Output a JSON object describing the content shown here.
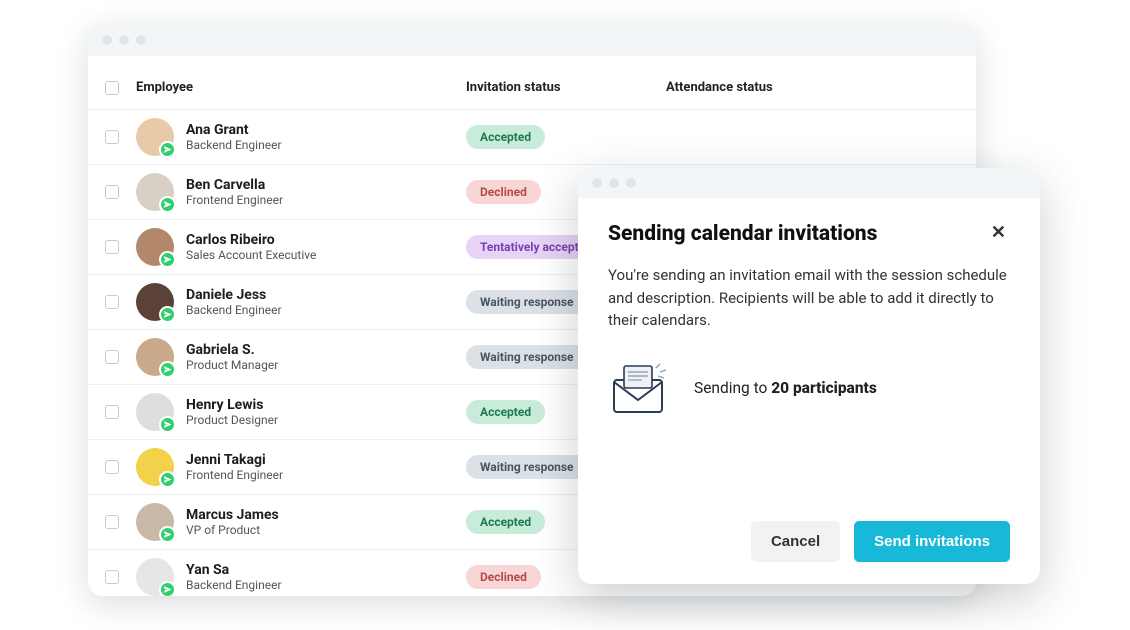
{
  "columns": {
    "employee": "Employee",
    "invitation": "Invitation status",
    "attendance": "Attendance status"
  },
  "status_labels": {
    "accepted": "Accepted",
    "declined": "Declined",
    "tentative": "Tentatively accepted",
    "waiting": "Waiting response"
  },
  "rows": [
    {
      "name": "Ana Grant",
      "role": "Backend Engineer",
      "status": "accepted"
    },
    {
      "name": "Ben Carvella",
      "role": "Frontend Engineer",
      "status": "declined"
    },
    {
      "name": "Carlos Ribeiro",
      "role": "Sales Account Executive",
      "status": "tentative"
    },
    {
      "name": "Daniele Jess",
      "role": "Backend Engineer",
      "status": "waiting"
    },
    {
      "name": "Gabriela S.",
      "role": "Product Manager",
      "status": "waiting"
    },
    {
      "name": "Henry Lewis",
      "role": "Product Designer",
      "status": "accepted"
    },
    {
      "name": "Jenni Takagi",
      "role": "Frontend Engineer",
      "status": "waiting"
    },
    {
      "name": "Marcus James",
      "role": "VP of Product",
      "status": "accepted"
    },
    {
      "name": "Yan Sa",
      "role": "Backend Engineer",
      "status": "declined"
    }
  ],
  "avatar_bg": [
    "#e8c9a8",
    "#d9d0c5",
    "#b3876a",
    "#5a4236",
    "#caa98a",
    "#dedede",
    "#f2d24a",
    "#c9b8a5",
    "#e6e6e6"
  ],
  "modal": {
    "title": "Sending calendar invitations",
    "description": "You're sending an invitation email with the session schedule and description. Recipients will be able to add it directly to their calendars.",
    "sending_prefix": "Sending to ",
    "sending_count": "20 participants",
    "cancel": "Cancel",
    "send": "Send invitations"
  }
}
